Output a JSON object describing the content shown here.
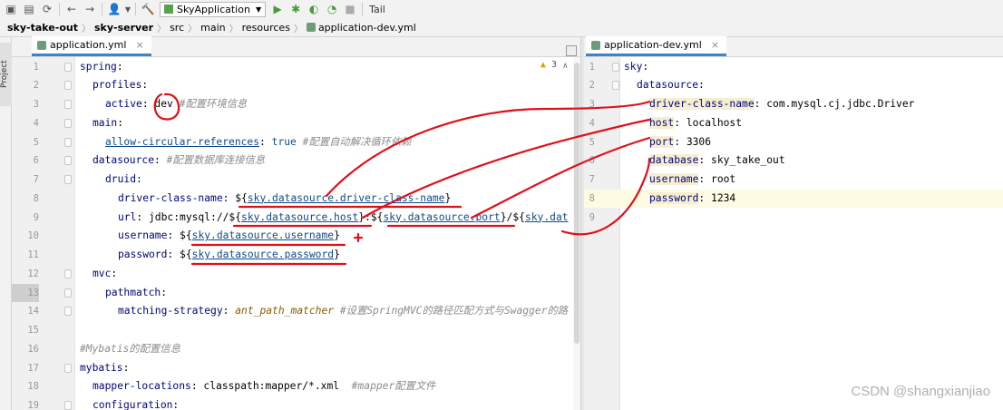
{
  "toolbar": {
    "run_config": "SkyApplication",
    "tail_label": "Tail",
    "icons": [
      "save-icon",
      "save-all-icon",
      "sync-icon",
      "back-icon",
      "forward-icon",
      "user-icon",
      "build-icon",
      "run-icon",
      "debug-icon",
      "coverage-icon",
      "profile-icon",
      "stop-icon",
      "pause-icon"
    ]
  },
  "breadcrumb": [
    "sky-take-out",
    "sky-server",
    "src",
    "main",
    "resources",
    "application-dev.yml"
  ],
  "side_panel_label": "Project",
  "left_editor": {
    "tab_label": "application.yml",
    "warning_count": "3",
    "lines": [
      {
        "n": "1",
        "indent": 0,
        "parts": [
          [
            "key",
            "spring"
          ],
          [
            "kw",
            ":"
          ]
        ]
      },
      {
        "n": "2",
        "indent": 1,
        "parts": [
          [
            "key",
            "profiles"
          ],
          [
            "kw",
            ":"
          ]
        ]
      },
      {
        "n": "3",
        "indent": 2,
        "parts": [
          [
            "key",
            "active"
          ],
          [
            "kw",
            ": "
          ],
          [
            "str",
            "dev "
          ],
          [
            "com",
            "#配置环境信息"
          ]
        ]
      },
      {
        "n": "4",
        "indent": 1,
        "parts": [
          [
            "key",
            "main"
          ],
          [
            "kw",
            ":"
          ]
        ]
      },
      {
        "n": "5",
        "indent": 2,
        "parts": [
          [
            "u-blue",
            "allow-circular-references"
          ],
          [
            "kw",
            ": "
          ],
          [
            "tval",
            "true "
          ],
          [
            "com",
            "#配置自动解决循环依赖"
          ]
        ]
      },
      {
        "n": "6",
        "indent": 1,
        "parts": [
          [
            "key",
            "datasource"
          ],
          [
            "kw",
            ": "
          ],
          [
            "com",
            "#配置数据库连接信息"
          ]
        ]
      },
      {
        "n": "7",
        "indent": 2,
        "parts": [
          [
            "key",
            "druid"
          ],
          [
            "kw",
            ":"
          ]
        ]
      },
      {
        "n": "8",
        "indent": 3,
        "parts": [
          [
            "key",
            "driver-class-name"
          ],
          [
            "kw",
            ": ${"
          ],
          [
            "u-blue",
            "sky.datasource.driver-class-name"
          ],
          [
            "kw",
            "}"
          ]
        ]
      },
      {
        "n": "9",
        "indent": 3,
        "parts": [
          [
            "key",
            "url"
          ],
          [
            "kw",
            ": jdbc:mysql://${"
          ],
          [
            "u-blue",
            "sky.datasource.host"
          ],
          [
            "kw",
            "}:${"
          ],
          [
            "u-blue",
            "sky.datasource.port"
          ],
          [
            "kw",
            "}/${"
          ],
          [
            "u-blue",
            "sky.dat"
          ]
        ]
      },
      {
        "n": "10",
        "indent": 3,
        "parts": [
          [
            "key",
            "username"
          ],
          [
            "kw",
            ": ${"
          ],
          [
            "u-blue",
            "sky.datasource.username"
          ],
          [
            "kw",
            "}"
          ]
        ]
      },
      {
        "n": "11",
        "indent": 3,
        "parts": [
          [
            "key",
            "password"
          ],
          [
            "kw",
            ": ${"
          ],
          [
            "u-blue",
            "sky.datasource.password"
          ],
          [
            "kw",
            "}"
          ]
        ]
      },
      {
        "n": "12",
        "indent": 1,
        "parts": [
          [
            "key",
            "mvc"
          ],
          [
            "kw",
            ":"
          ]
        ]
      },
      {
        "n": "13",
        "indent": 2,
        "parts": [
          [
            "key",
            "pathmatch"
          ],
          [
            "kw",
            ":"
          ]
        ]
      },
      {
        "n": "14",
        "indent": 3,
        "parts": [
          [
            "key",
            "matching-strategy"
          ],
          [
            "kw",
            ": "
          ],
          [
            "iv",
            "ant_path_matcher "
          ],
          [
            "com",
            "#设置SpringMVC的路径匹配方式与Swagger的路"
          ]
        ]
      },
      {
        "n": "15",
        "indent": 0,
        "parts": []
      },
      {
        "n": "16",
        "indent": 0,
        "parts": [
          [
            "com",
            "#Mybatis的配置信息"
          ]
        ]
      },
      {
        "n": "17",
        "indent": 0,
        "parts": [
          [
            "key",
            "mybatis"
          ],
          [
            "kw",
            ":"
          ]
        ]
      },
      {
        "n": "18",
        "indent": 1,
        "parts": [
          [
            "key",
            "mapper-locations"
          ],
          [
            "kw",
            ": classpath:mapper/*.xml  "
          ],
          [
            "com",
            "#mapper配置文件"
          ]
        ]
      },
      {
        "n": "19",
        "indent": 1,
        "parts": [
          [
            "key",
            "configuration"
          ],
          [
            "kw",
            ":"
          ]
        ]
      }
    ]
  },
  "right_editor": {
    "tab_label": "application-dev.yml",
    "lines": [
      {
        "n": "1",
        "indent": 0,
        "parts": [
          [
            "key",
            "sky"
          ],
          [
            "kw",
            ":"
          ]
        ]
      },
      {
        "n": "2",
        "indent": 1,
        "parts": [
          [
            "key",
            "datasource"
          ],
          [
            "kw",
            ":"
          ]
        ]
      },
      {
        "n": "3",
        "indent": 2,
        "parts": [
          [
            "key",
            "driver-class-name"
          ],
          [
            "kw",
            ": com.mysql.cj.jdbc.Driver"
          ]
        ]
      },
      {
        "n": "4",
        "indent": 2,
        "parts": [
          [
            "key",
            "host"
          ],
          [
            "kw",
            ": localhost"
          ]
        ]
      },
      {
        "n": "5",
        "indent": 2,
        "parts": [
          [
            "key",
            "port"
          ],
          [
            "kw",
            ": 3306"
          ]
        ]
      },
      {
        "n": "6",
        "indent": 2,
        "parts": [
          [
            "key",
            "database"
          ],
          [
            "kw",
            ": sky_take_out"
          ]
        ]
      },
      {
        "n": "7",
        "indent": 2,
        "parts": [
          [
            "key",
            "username"
          ],
          [
            "kw",
            ": root"
          ]
        ]
      },
      {
        "n": "8",
        "indent": 2,
        "parts": [
          [
            "key",
            "password"
          ],
          [
            "kw",
            ": 1234"
          ]
        ]
      },
      {
        "n": "9",
        "indent": 0,
        "parts": []
      }
    ]
  },
  "watermark": "CSDN @shangxianjiao"
}
